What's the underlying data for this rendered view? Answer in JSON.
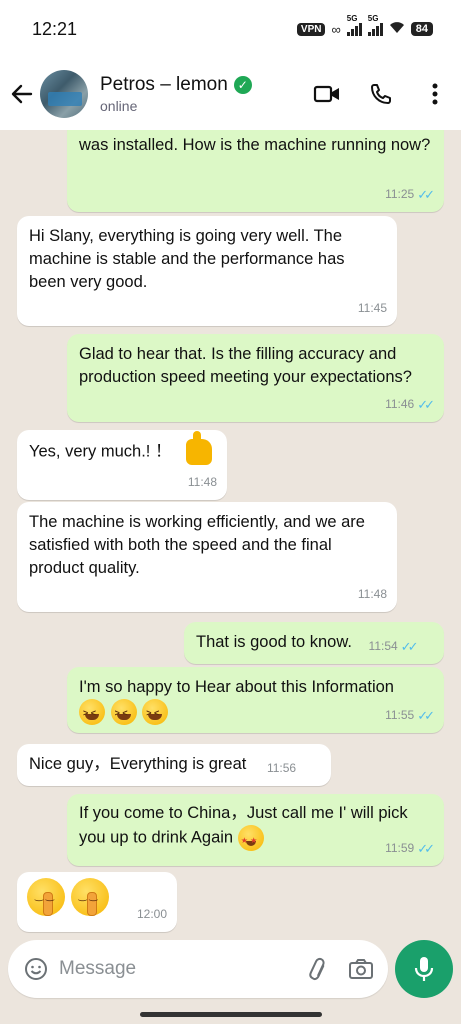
{
  "status_bar": {
    "time": "12:21",
    "vpn": "VPN",
    "net1": "5G",
    "net2": "5G",
    "battery": "84"
  },
  "header": {
    "contact_name": "Petros – lemon",
    "status": "online"
  },
  "messages": [
    {
      "dir": "out",
      "text": "was installed. How is the machine running now?",
      "time": "11:25",
      "read": true
    },
    {
      "dir": "in",
      "text": "Hi Slany, everything is going very well. The machine is stable and the performance has been very good.",
      "time": "11:45"
    },
    {
      "dir": "out",
      "text": "Glad to hear that. Is the filling accuracy and production speed meeting your expectations?",
      "time": "11:46",
      "read": true
    },
    {
      "dir": "in",
      "text": "Yes, very much.! ！",
      "time": "11:48"
    },
    {
      "dir": "in",
      "text": "The machine is working efficiently, and we are satisfied with both the speed and the final product quality.",
      "time": "11:48"
    },
    {
      "dir": "out",
      "text": "That is good to know.",
      "time": "11:54",
      "read": true
    },
    {
      "dir": "out",
      "text": "I'm so happy to Hear about this Information",
      "time": "11:55",
      "read": true
    },
    {
      "dir": "in",
      "text": "Nice guy，Everything is great",
      "time": "11:56"
    },
    {
      "dir": "out",
      "text": "If you come to China，Just call me I' will pick you up to drink Again",
      "time": "11:59",
      "read": true
    },
    {
      "dir": "in",
      "text": "",
      "time": "12:00"
    }
  ],
  "composer": {
    "placeholder": "Message"
  },
  "colors": {
    "outgoing_bubble": "#dcf8c6",
    "incoming_bubble": "#ffffff",
    "read_ticks": "#53bdeb",
    "accent_green": "#1aa06b",
    "verified_green": "#1fa855",
    "chat_background": "#ece5dd"
  },
  "icons": [
    "back-arrow-icon",
    "verified-badge-icon",
    "video-call-icon",
    "voice-call-icon",
    "more-options-icon",
    "emoji-icon",
    "attach-icon",
    "camera-icon",
    "mic-icon"
  ]
}
